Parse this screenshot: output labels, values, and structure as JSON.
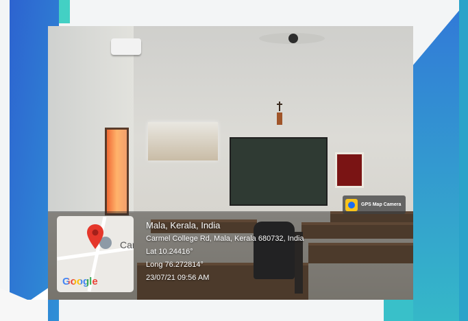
{
  "badge": {
    "label": "GPS Map Camera"
  },
  "map": {
    "place_label": "Carm",
    "google_label": "Google"
  },
  "location": {
    "title": "Mala, Kerala, India",
    "address": "Carmel College Rd, Mala, Kerala 680732, India",
    "lat": "Lat 10.24416°",
    "long": "Long 76.272814°",
    "datetime": "23/07/21 09:56 AM"
  },
  "colors": {
    "frame_blue": "#2d6fd6",
    "frame_teal": "#35c2c6",
    "pin_red": "#e5372b"
  }
}
